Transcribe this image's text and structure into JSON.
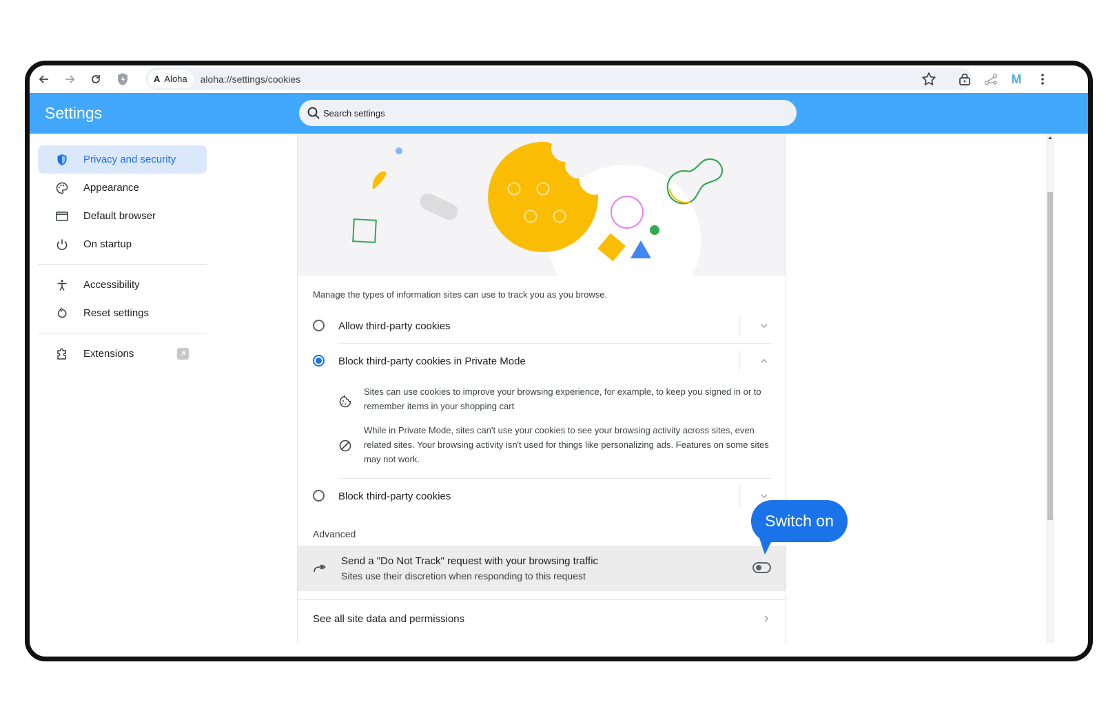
{
  "browser": {
    "site_chip": "Aloha",
    "url": "aloha://settings/cookies",
    "profile_initial": "M"
  },
  "header": {
    "title": "Settings",
    "search_placeholder": "Search settings"
  },
  "sidebar": {
    "items": [
      {
        "label": "Privacy and security",
        "icon": "shield-icon",
        "active": true
      },
      {
        "label": "Appearance",
        "icon": "palette-icon",
        "active": false
      },
      {
        "label": "Default browser",
        "icon": "browser-window-icon",
        "active": false
      },
      {
        "label": "On startup",
        "icon": "power-icon",
        "active": false
      },
      {
        "label": "Accessibility",
        "icon": "accessibility-icon",
        "active": false
      },
      {
        "label": "Reset settings",
        "icon": "reset-icon",
        "active": false
      },
      {
        "label": "Extensions",
        "icon": "puzzle-icon",
        "active": false
      }
    ]
  },
  "main": {
    "description": "Manage the types of information sites can use to track you as you browse.",
    "options": [
      {
        "label": "Allow third-party cookies",
        "selected": false,
        "expanded": false
      },
      {
        "label": "Block third-party cookies in Private Mode",
        "selected": true,
        "expanded": true
      },
      {
        "label": "Block third-party cookies",
        "selected": false,
        "expanded": false
      }
    ],
    "details": [
      {
        "icon": "cookie-icon",
        "text": "Sites can use cookies to improve your browsing experience, for example, to keep you signed in or to remember items in your shopping cart"
      },
      {
        "icon": "block-icon",
        "text": "While in Private Mode, sites can't use your cookies to see your browsing activity across sites, even related sites. Your browsing activity isn't used for things like personalizing ads. Features on some sites may not work."
      }
    ],
    "advanced_heading": "Advanced",
    "dnt": {
      "title": "Send a \"Do Not Track\" request with your browsing traffic",
      "subtitle": "Sites use their discretion when responding to this request",
      "enabled": false
    },
    "see_all": "See all site data and permissions"
  },
  "callout": {
    "text": "Switch on"
  },
  "colors": {
    "header": "#41a7fb",
    "accent": "#1a73e8",
    "active_nav_bg": "#dbe7fb"
  }
}
